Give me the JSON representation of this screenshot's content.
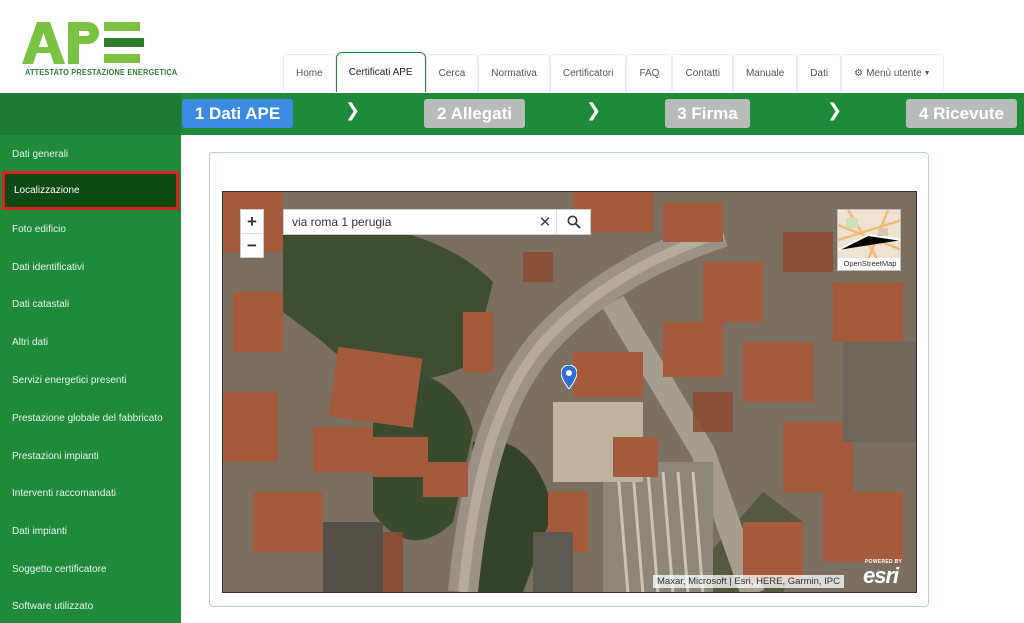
{
  "logo": {
    "name": "APE",
    "tagline": "ATTESTATO PRESTAZIONE ENERGETICA"
  },
  "nav": {
    "tabs": [
      {
        "label": "Home"
      },
      {
        "label": "Certificati APE"
      },
      {
        "label": "Cerca"
      },
      {
        "label": "Normativa"
      },
      {
        "label": "Certificatori"
      },
      {
        "label": "FAQ"
      },
      {
        "label": "Contatti"
      },
      {
        "label": "Manuale"
      },
      {
        "label": "Dati"
      },
      {
        "label": "Menù utente"
      }
    ],
    "active_tab": "Certificati APE"
  },
  "steps": [
    {
      "label": "1 Dati APE",
      "state": "active"
    },
    {
      "label": "2 Allegati",
      "state": "inactive"
    },
    {
      "label": "3 Firma",
      "state": "inactive"
    },
    {
      "label": "4 Ricevute",
      "state": "inactive"
    }
  ],
  "sidebar": {
    "items": [
      {
        "label": "Dati generali"
      },
      {
        "label": "Localizzazione"
      },
      {
        "label": "Foto edificio"
      },
      {
        "label": "Dati identificativi"
      },
      {
        "label": "Dati catastali"
      },
      {
        "label": "Altri dati"
      },
      {
        "label": "Servizi energetici presenti"
      },
      {
        "label": "Prestazione globale del fabbricato"
      },
      {
        "label": "Prestazioni impianti"
      },
      {
        "label": "Interventi raccomandati"
      },
      {
        "label": "Dati impianti"
      },
      {
        "label": "Soggetto certificatore"
      },
      {
        "label": "Software utilizzato"
      }
    ],
    "active_item": "Localizzazione"
  },
  "map": {
    "zoom_in": "+",
    "zoom_out": "−",
    "search": {
      "value": "via roma 1 perugia"
    },
    "basemap_label": "OpenStreetMap",
    "attribution": "Maxar, Microsoft | Esri, HERE, Garmin, IPC",
    "esri_powered": "POWERED BY",
    "esri_logo": "esri"
  },
  "colors": {
    "green": "#1e8a3a",
    "active_step": "#3c8be0",
    "inactive_step": "#b8bcb9",
    "highlight": "#e02020"
  }
}
